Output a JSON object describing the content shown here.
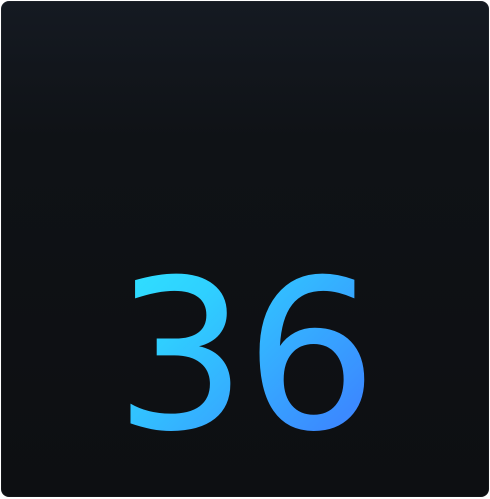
{
  "tile": {
    "value": "36"
  },
  "colors": {
    "background_top": "#151a22",
    "background_bottom": "#0d0f12",
    "gradient_start": "#2ef6ff",
    "gradient_end": "#4a6cff"
  }
}
